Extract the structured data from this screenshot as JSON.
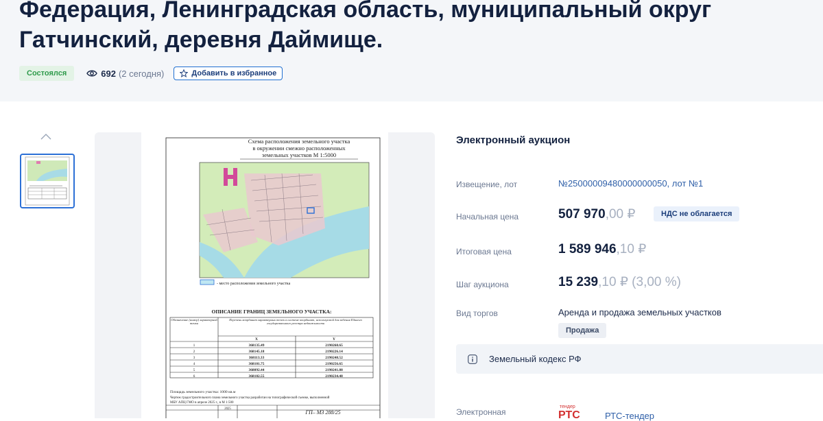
{
  "header": {
    "title_line1": "Федерация, Ленинградская область, муниципальный округ",
    "title_line2": "Гатчинский, деревня Даймище.",
    "status": "Состоялся",
    "views_count": "692",
    "views_today": "(2 сегодня)",
    "favorite_label": "Добавить в избранное"
  },
  "document": {
    "scheme_title_1": "Схема расположения земельного участка",
    "scheme_title_2": "в окружении смежно расположенных",
    "scheme_title_3": "земельных участков М 1:5000",
    "legend_text": "- место расположения земельного участка",
    "boundaries_title": "ОПИСАНИЕ ГРАНИЦ ЗЕМЕЛЬНОГО УЧАСТКА:",
    "col1_header": "Обозначение (номер) характерной точки",
    "col2_header": "Перечень координат характерных точек в системе координат, используемой для ведения Единого государственного реестра недвижимости",
    "x_header": "X",
    "y_header": "Y",
    "rows": [
      {
        "n": "1",
        "x": "368135.49",
        "y": "2190268.65"
      },
      {
        "n": "2",
        "x": "368145.18",
        "y": "2190226.14"
      },
      {
        "n": "3",
        "x": "368113.33",
        "y": "2190248.52"
      },
      {
        "n": "4",
        "x": "368101.75",
        "y": "2190256.65"
      },
      {
        "n": "5",
        "x": "368092.44",
        "y": "2190241.88"
      },
      {
        "n": "6",
        "x": "368102.55",
        "y": "2190234.48"
      }
    ],
    "area_note": "Площадь земельного участка: 1000 кв.м",
    "plan_note_1": "Чертеж градостроительного плана земельного участка разработан на топографической съемке, выполненной",
    "plan_note_2": "МБУ АПЦ ГМО в апреле 2025 г., в М 1:500",
    "year_cell": "2025",
    "doc_code": "ГП– МЗ 288/25"
  },
  "panel": {
    "auction_type": "Электронный аукцион",
    "notice_label": "Извещение, лот",
    "notice_value": "№25000009480000000050, лот №1",
    "start_price_label": "Начальная цена",
    "start_price_main": "507 970",
    "start_price_kop": ",00 ₽",
    "vat_badge": "НДС не облагается",
    "final_price_label": "Итоговая цена",
    "final_price_main": "1 589 946",
    "final_price_kop": ",10 ₽",
    "step_label": "Шаг аукциона",
    "step_main": "15 239",
    "step_kop": ",10 ₽ (3,00 %)",
    "trade_type_label": "Вид торгов",
    "trade_type_value": "Аренда и продажа земельных участков",
    "sale_badge": "Продажа",
    "law": "Земельный кодекс РФ",
    "platform_label": "Электронная",
    "platform_value": "РТС-тендер",
    "logo_top": "тендер",
    "logo_main": "РТС"
  },
  "colors": {
    "accent": "#1f6fd1",
    "status_green": "#2e9a4a",
    "title": "#13213f",
    "link": "#2e5fa8"
  }
}
